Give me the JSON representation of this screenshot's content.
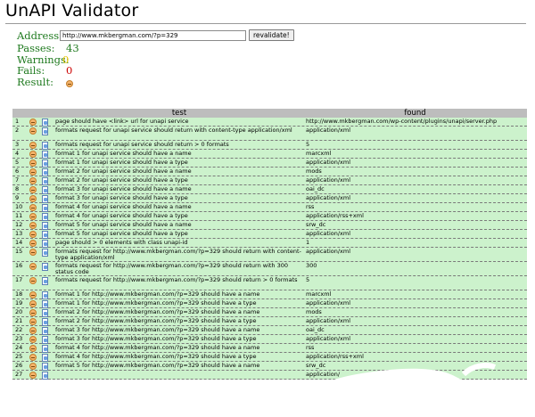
{
  "page": {
    "title": "UnAPI Validator"
  },
  "summary": {
    "address_label": "Address:",
    "address_value": "http://www.mkbergman.com/?p=329",
    "revalidate_label": "revalidate!",
    "passes_label": "Passes:",
    "passes_value": "43",
    "warnings_label": "Warnings:",
    "warnings_value": "0",
    "fails_label": "Fails:",
    "fails_value": "0",
    "result_label": "Result:",
    "result_icon": "smiley-icon"
  },
  "table": {
    "headers": {
      "test": "test",
      "found": "found"
    },
    "status_icon": "smiley-icon",
    "detail_icon": "document-icon",
    "colors": {
      "row_bg": "#ccf2cc",
      "header_bg": "#bdbdbd"
    },
    "rows": [
      {
        "num": "1",
        "test": "page should have <link> url for unapi service",
        "found": "http://www.mkbergman.com/wp-content/plugins/unapi/server.php",
        "lines": 1
      },
      {
        "num": "2",
        "test": "formats request for unapi service should return with content-type application/xml",
        "found": "application/xml",
        "lines": 2
      },
      {
        "num": "3",
        "test": "formats request for unapi service should return > 0 formats",
        "found": "5",
        "lines": 1
      },
      {
        "num": "4",
        "test": "format 1 for unapi service should have a name",
        "found": "marcxml",
        "lines": 1
      },
      {
        "num": "5",
        "test": "format 1 for unapi service should have a type",
        "found": "application/xml",
        "lines": 1
      },
      {
        "num": "6",
        "test": "format 2 for unapi service should have a name",
        "found": "mods",
        "lines": 1
      },
      {
        "num": "7",
        "test": "format 2 for unapi service should have a type",
        "found": "application/xml",
        "lines": 1
      },
      {
        "num": "8",
        "test": "format 3 for unapi service should have a name",
        "found": "oai_dc",
        "lines": 1
      },
      {
        "num": "9",
        "test": "format 3 for unapi service should have a type",
        "found": "application/xml",
        "lines": 1
      },
      {
        "num": "10",
        "test": "format 4 for unapi service should have a name",
        "found": "rss",
        "lines": 1
      },
      {
        "num": "11",
        "test": "format 4 for unapi service should have a type",
        "found": "application/rss+xml",
        "lines": 1
      },
      {
        "num": "12",
        "test": "format 5 for unapi service should have a name",
        "found": "srw_dc",
        "lines": 1
      },
      {
        "num": "13",
        "test": "format 5 for unapi service should have a type",
        "found": "application/xml",
        "lines": 1
      },
      {
        "num": "14",
        "test": "page should > 0 elements with class unapi-id",
        "found": "1",
        "lines": 1
      },
      {
        "num": "15",
        "test": "formats request for http://www.mkbergman.com/?p=329 should return with content-type application/xml",
        "found": "application/xml",
        "lines": 2
      },
      {
        "num": "16",
        "test": "formats request for http://www.mkbergman.com/?p=329 should return with 300 status code",
        "found": "300",
        "lines": 2
      },
      {
        "num": "17",
        "test": "formats request for http://www.mkbergman.com/?p=329 should return > 0 formats",
        "found": "5",
        "lines": 2
      },
      {
        "num": "18",
        "test": "format 1 for http://www.mkbergman.com/?p=329 should have a name",
        "found": "marcxml",
        "lines": 1
      },
      {
        "num": "19",
        "test": "format 1 for http://www.mkbergman.com/?p=329 should have a type",
        "found": "application/xml",
        "lines": 1
      },
      {
        "num": "20",
        "test": "format 2 for http://www.mkbergman.com/?p=329 should have a name",
        "found": "mods",
        "lines": 1
      },
      {
        "num": "21",
        "test": "format 2 for http://www.mkbergman.com/?p=329 should have a type",
        "found": "application/xml",
        "lines": 1
      },
      {
        "num": "22",
        "test": "format 3 for http://www.mkbergman.com/?p=329 should have a name",
        "found": "oai_dc",
        "lines": 1
      },
      {
        "num": "23",
        "test": "format 3 for http://www.mkbergman.com/?p=329 should have a type",
        "found": "application/xml",
        "lines": 1
      },
      {
        "num": "24",
        "test": "format 4 for http://www.mkbergman.com/?p=329 should have a name",
        "found": "rss",
        "lines": 1
      },
      {
        "num": "25",
        "test": "format 4 for http://www.mkbergman.com/?p=329 should have a type",
        "found": "application/rss+xml",
        "lines": 1
      },
      {
        "num": "26",
        "test": "format 5 for http://www.mkbergman.com/?p=329 should have a name",
        "found": "srw_dc",
        "lines": 1
      },
      {
        "num": "27",
        "test": "",
        "found": "application/",
        "lines": 1
      }
    ]
  }
}
